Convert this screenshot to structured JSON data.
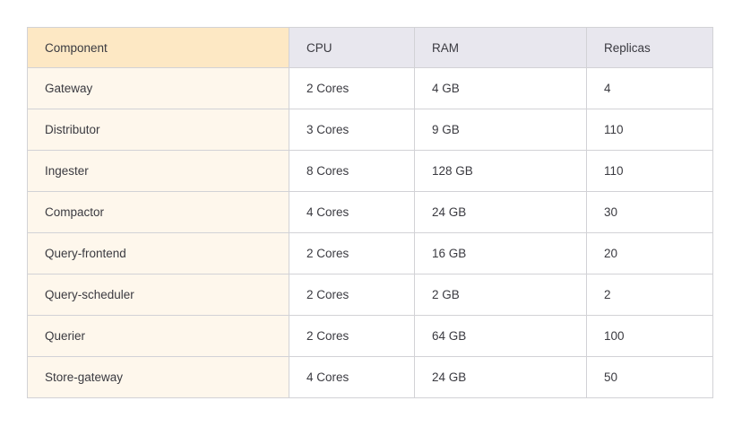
{
  "table": {
    "headers": [
      "Component",
      "CPU",
      "RAM",
      "Replicas"
    ],
    "rows": [
      [
        "Gateway",
        "2 Cores",
        "4 GB",
        "4"
      ],
      [
        "Distributor",
        "3 Cores",
        "9 GB",
        "110"
      ],
      [
        "Ingester",
        "8 Cores",
        "128 GB",
        "110"
      ],
      [
        "Compactor",
        "4 Cores",
        "24 GB",
        "30"
      ],
      [
        "Query-frontend",
        "2 Cores",
        "16 GB",
        "20"
      ],
      [
        "Query-scheduler",
        "2 Cores",
        "2 GB",
        "2"
      ],
      [
        "Querier",
        "2 Cores",
        "64 GB",
        "100"
      ],
      [
        "Store-gateway",
        "4 Cores",
        "24 GB",
        "50"
      ]
    ]
  },
  "colors": {
    "header_highlight": "#fde8c4",
    "header": "#e8e7ee",
    "first_column": "#fef7ec",
    "border": "#d2d2d6",
    "text": "#3a3a40"
  }
}
